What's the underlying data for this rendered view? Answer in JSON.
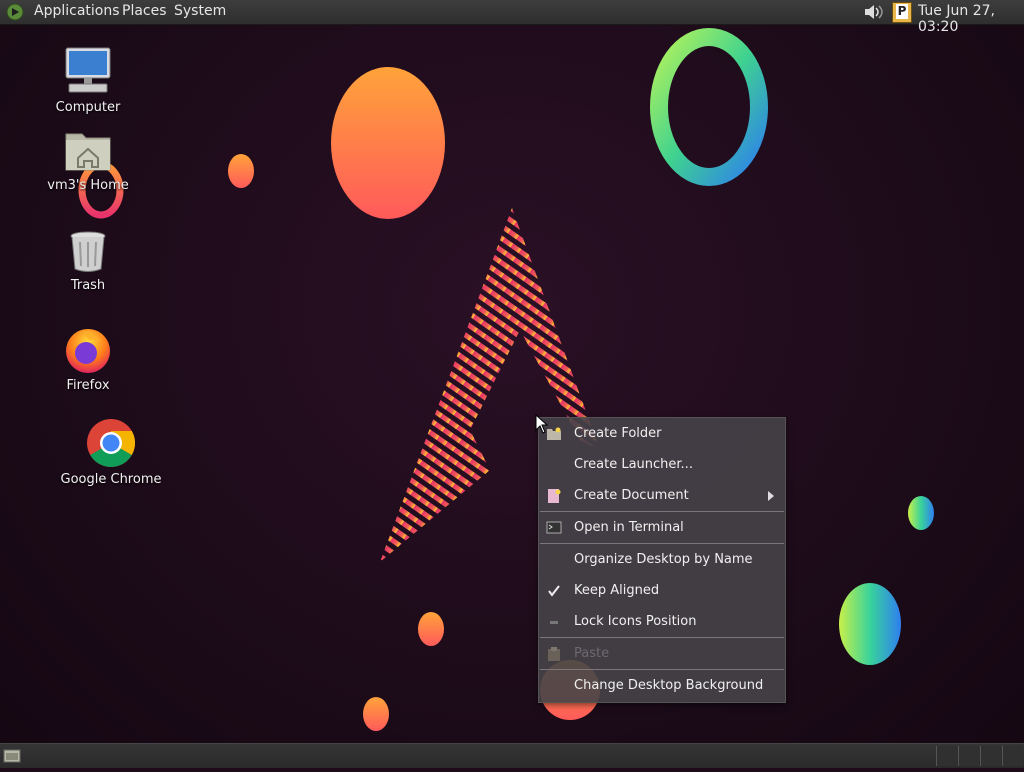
{
  "top_panel": {
    "menus": [
      "Applications",
      "Places",
      "System"
    ],
    "clock": "Tue Jun 27, 03:20",
    "indicator_letter": "P"
  },
  "desktop_icons": [
    {
      "label": "Computer",
      "icon": "computer-icon"
    },
    {
      "label": "vm3's Home",
      "icon": "home-folder-icon"
    },
    {
      "label": "Trash",
      "icon": "trash-icon"
    },
    {
      "label": "Firefox",
      "icon": "firefox-icon"
    },
    {
      "label": "Google Chrome",
      "icon": "chrome-icon"
    }
  ],
  "context_menu": {
    "items": [
      {
        "label": "Create Folder",
        "icon": "folder-icon"
      },
      {
        "label": "Create Launcher...",
        "icon": ""
      },
      {
        "label": "Create Document",
        "icon": "document-icon",
        "submenu": true
      },
      {
        "label": "Open in Terminal",
        "icon": "terminal-icon"
      },
      {
        "label": "Organize Desktop by Name",
        "icon": ""
      },
      {
        "label": "Keep Aligned",
        "icon": "checkmark-icon",
        "checked": true
      },
      {
        "label": "Lock Icons Position",
        "icon": "unchecked-box-icon"
      },
      {
        "label": "Paste",
        "icon": "clipboard-icon",
        "disabled": true
      },
      {
        "label": "Change Desktop Background",
        "icon": ""
      }
    ]
  },
  "colors": {
    "panel": "#353535",
    "menu_bg": "#464248",
    "accent_pink": "#e8336b",
    "accent_orange": "#ff9a3c"
  }
}
